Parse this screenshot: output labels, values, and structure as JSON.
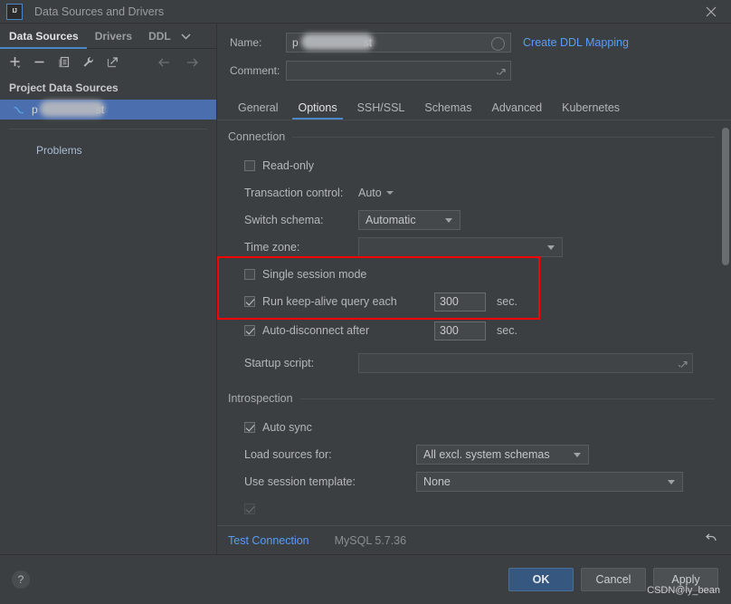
{
  "window": {
    "title": "Data Sources and Drivers",
    "logo_text": "IJ",
    "close_icon": "close-icon"
  },
  "sidebar": {
    "tabs": [
      {
        "label": "Data Sources",
        "active": true
      },
      {
        "label": "Drivers",
        "active": false
      },
      {
        "label": "DDL",
        "active": false
      }
    ],
    "tab_overflow_icon": "chevron-down-icon",
    "toolbar": [
      {
        "icon": "add-icon",
        "glyph": "+"
      },
      {
        "icon": "remove-icon",
        "glyph": "−"
      },
      {
        "icon": "copy-icon",
        "glyph": "❐"
      },
      {
        "icon": "wrench-icon",
        "glyph": "🔧"
      },
      {
        "icon": "export-icon",
        "glyph": "↗"
      }
    ],
    "nav": [
      {
        "icon": "back-arrow-icon",
        "glyph": "←"
      },
      {
        "icon": "forward-arrow-icon",
        "glyph": "→"
      }
    ],
    "group_title": "Project Data Sources",
    "items": [
      {
        "label_prefix": "p",
        "label_suffix": "st",
        "redacted": true,
        "selected": true,
        "icon": "mysql-dolphin-icon"
      }
    ],
    "problems_link": "Problems"
  },
  "details": {
    "name_label": "Name:",
    "name_value_prefix": "p",
    "name_value_suffix": "st",
    "name_redacted": true,
    "name_indicator_icon": "circle-indicator-icon",
    "comment_label": "Comment:",
    "comment_value": "",
    "comment_expand_icon": "expand-icon",
    "ddl_mapping_link": "Create DDL Mapping",
    "tabs": [
      {
        "label": "General",
        "active": false
      },
      {
        "label": "Options",
        "active": true
      },
      {
        "label": "SSH/SSL",
        "active": false
      },
      {
        "label": "Schemas",
        "active": false
      },
      {
        "label": "Advanced",
        "active": false
      },
      {
        "label": "Kubernetes",
        "active": false
      }
    ]
  },
  "connection": {
    "group_title": "Connection",
    "read_only": {
      "label": "Read-only",
      "checked": false
    },
    "transaction_control": {
      "label": "Transaction control:",
      "value": "Auto"
    },
    "switch_schema": {
      "label": "Switch schema:",
      "value": "Automatic"
    },
    "time_zone": {
      "label": "Time zone:",
      "value": ""
    },
    "single_session_mode": {
      "label": "Single session mode",
      "checked": false
    },
    "keep_alive": {
      "label": "Run keep-alive query each",
      "checked": true,
      "value": "300",
      "unit": "sec."
    },
    "auto_disconnect": {
      "label": "Auto-disconnect after",
      "checked": true,
      "value": "300",
      "unit": "sec."
    },
    "startup_script": {
      "label": "Startup script:",
      "value": "",
      "expand_icon": "expand-icon"
    }
  },
  "introspection": {
    "group_title": "Introspection",
    "auto_sync": {
      "label": "Auto sync",
      "checked": true
    },
    "load_sources_for": {
      "label": "Load sources for:",
      "value": "All excl. system schemas"
    },
    "use_session_template": {
      "label": "Use session template:",
      "value": "None"
    }
  },
  "status": {
    "test_connection": "Test Connection",
    "database_version": "MySQL 5.7.36",
    "reset_icon": "reset-icon",
    "reset_glyph": "↶"
  },
  "footer": {
    "help_icon": "help-icon",
    "help_glyph": "?",
    "buttons": [
      {
        "label": "OK",
        "primary": true
      },
      {
        "label": "Cancel",
        "primary": false
      },
      {
        "label": "Apply",
        "primary": false
      }
    ],
    "watermark": "CSDN@ly_bean"
  },
  "colors": {
    "background": "#3c3f41",
    "accent_blue": "#4a88c7",
    "link_blue": "#589df6",
    "selection_blue": "#4b6eaf",
    "highlight_red": "#fe0000",
    "primary_button": "#365880"
  }
}
